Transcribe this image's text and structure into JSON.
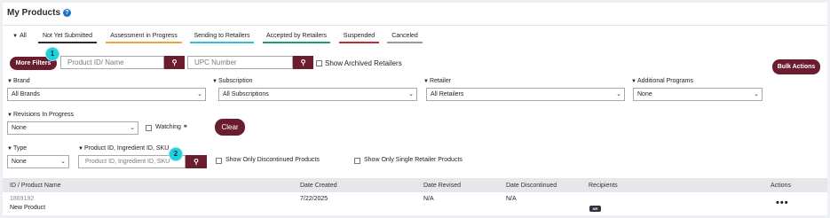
{
  "page": {
    "title": "My Products",
    "help_icon": "question-circle-icon"
  },
  "tabs": [
    {
      "label": "All",
      "accent": ""
    },
    {
      "label": "Not Yet Submitted",
      "accent": "#2b2b2b"
    },
    {
      "label": "Assessment in Progress",
      "accent": "#f0a23a"
    },
    {
      "label": "Sending to Retailers",
      "accent": "#2cc1d9"
    },
    {
      "label": "Accepted by Retailers",
      "accent": "#1c9d7a"
    },
    {
      "label": "Suspended",
      "accent": "#c7283a"
    },
    {
      "label": "Canceled",
      "accent": "#9a9a9a"
    }
  ],
  "search": {
    "more_filters": "More Filters",
    "product_placeholder": "Product ID/ Name",
    "upc_placeholder": "UPC Number",
    "show_archived": "Show Archived Retailers",
    "bulk_actions": "Bulk Actions"
  },
  "filters": {
    "brand": {
      "label": "Brand",
      "value": "All Brands"
    },
    "subscription": {
      "label": "Subscription",
      "value": "All Subscriptions"
    },
    "retailer": {
      "label": "Retailer",
      "value": "All Retailers"
    },
    "additional_programs": {
      "label": "Additional Programs",
      "value": "None"
    },
    "revisions": {
      "label": "Revisions In Progress",
      "value": "None"
    },
    "watching": "Watching",
    "clear": "Clear",
    "type": {
      "label": "Type",
      "value": "None"
    },
    "product_id": {
      "label": "Product ID, Ingredient ID, SKU",
      "placeholder": "Product ID, Ingredient ID, SKU"
    },
    "show_discontinued": "Show Only Discontinued Products",
    "show_single_retailer": "Show Only Single Retailer Products"
  },
  "badges": [
    "1",
    "2"
  ],
  "table": {
    "columns": [
      "ID / Product Name",
      "Date Created",
      "Date Revised",
      "Date Discontinued",
      "Recipients",
      "Actions"
    ],
    "rows": [
      {
        "id": "1869192",
        "name": "New Product",
        "created": "7/22/2025",
        "revised": "N/A",
        "discontinued": "N/A",
        "recipient": "NR",
        "actions": "•••"
      }
    ]
  },
  "colors": {
    "brand": "#6b1d2f",
    "accent_blue": "#1a73c7",
    "badge": "#1fd0dd"
  }
}
